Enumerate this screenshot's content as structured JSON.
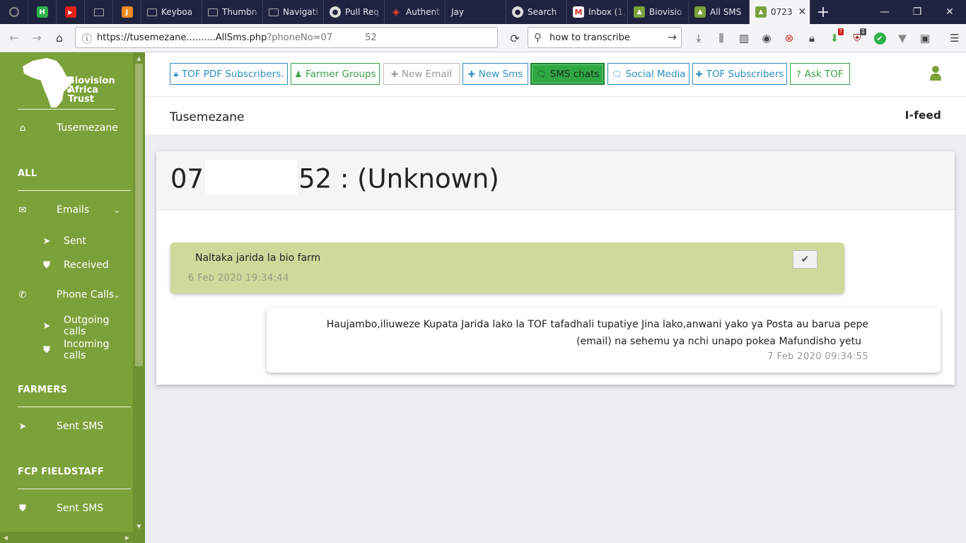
{
  "browser": {
    "tabs": [
      {
        "label": "",
        "icon": "circle-record-icon",
        "icon_color": "#888888"
      },
      {
        "label": "",
        "icon": "h-app-icon",
        "icon_color": "#2db34a"
      },
      {
        "label": "",
        "icon": "youtube-icon",
        "icon_color": "#e62117"
      },
      {
        "label": "",
        "icon": "monitor-icon",
        "icon_color": "#aaaaaa"
      },
      {
        "label": "",
        "icon": "j-app-icon",
        "icon_color": "#f08a24"
      },
      {
        "label": "Keyboa",
        "icon": "monitor-icon"
      },
      {
        "label": "Thumbn",
        "icon": "monitor-icon"
      },
      {
        "label": "Navigati",
        "icon": "monitor-icon"
      },
      {
        "label": "Pull Req",
        "icon": "github-icon"
      },
      {
        "label": "Authent",
        "icon": "laravel-icon"
      },
      {
        "label": "Jay",
        "icon": ""
      },
      {
        "label": "Search",
        "icon": "github-icon"
      },
      {
        "label": "Inbox (1,",
        "icon": "gmail-icon"
      },
      {
        "label": "Biovisio",
        "icon": "biovision-icon"
      },
      {
        "label": "All SMS",
        "icon": "biovision-icon"
      },
      {
        "label": "0723",
        "icon": "biovision-icon",
        "active": true
      }
    ],
    "url": {
      "host": "https://tusemezane..........AllSms.php",
      "query_start": "?phoneNo=07",
      "query_end": "52"
    },
    "search": {
      "value": "how to transcribe"
    },
    "toolbar_badges": {
      "red": "?",
      "shield": "1"
    }
  },
  "sidebar": {
    "logo_text": [
      "Biovision",
      "Africa",
      "Trust"
    ],
    "home_label": "Tusemezane",
    "sections": {
      "all": "ALL",
      "farmers": "FARMERS",
      "fcp": "FCP FIELDSTAFF"
    },
    "items": {
      "emails": "Emails",
      "sent": "Sent",
      "received": "Received",
      "phone_calls": "Phone Calls",
      "outgoing": "Outgoing calls",
      "incoming": "Incoming calls",
      "farmers_sent_sms": "Sent SMS",
      "fcp_sent_sms": "Sent SMS"
    }
  },
  "topnav": {
    "tof_pdf": "TOF PDF Subscribers.",
    "farmer_groups": "Farmer Groups",
    "new_email": "New Email",
    "new_sms": "New Sms",
    "sms_chats": "SMS chats",
    "social_media": "Social Media",
    "tof_subscribers": "TOF Subscribers",
    "ask_tof": "Ask TOF"
  },
  "brand": {
    "name": "Tusemezane",
    "ifeed": "I-feed"
  },
  "chat": {
    "title_prefix": "07",
    "title_suffix": "52 : (Unknown)",
    "messages": [
      {
        "direction": "in",
        "text": "Naltaka jarida la bio farm",
        "time": "6 Feb 2020 19:34:44"
      },
      {
        "direction": "out",
        "line1": "Haujambo,iliuweze Kupata Jarida lako la TOF tafadhali tupatiye Jina lako,anwani yako ya Posta au barua pepe",
        "line2": "(email) na sehemu ya nchi unapo pokea Mafundisho yetu",
        "time": "7 Feb 2020 09:34:55"
      }
    ]
  },
  "colors": {
    "sidebar": "#7ba23a",
    "accent_blue": "#2b8fc4",
    "accent_green": "#3aa04a",
    "active_button": "#2fa844",
    "incoming_bubble": "#cfd99b"
  }
}
